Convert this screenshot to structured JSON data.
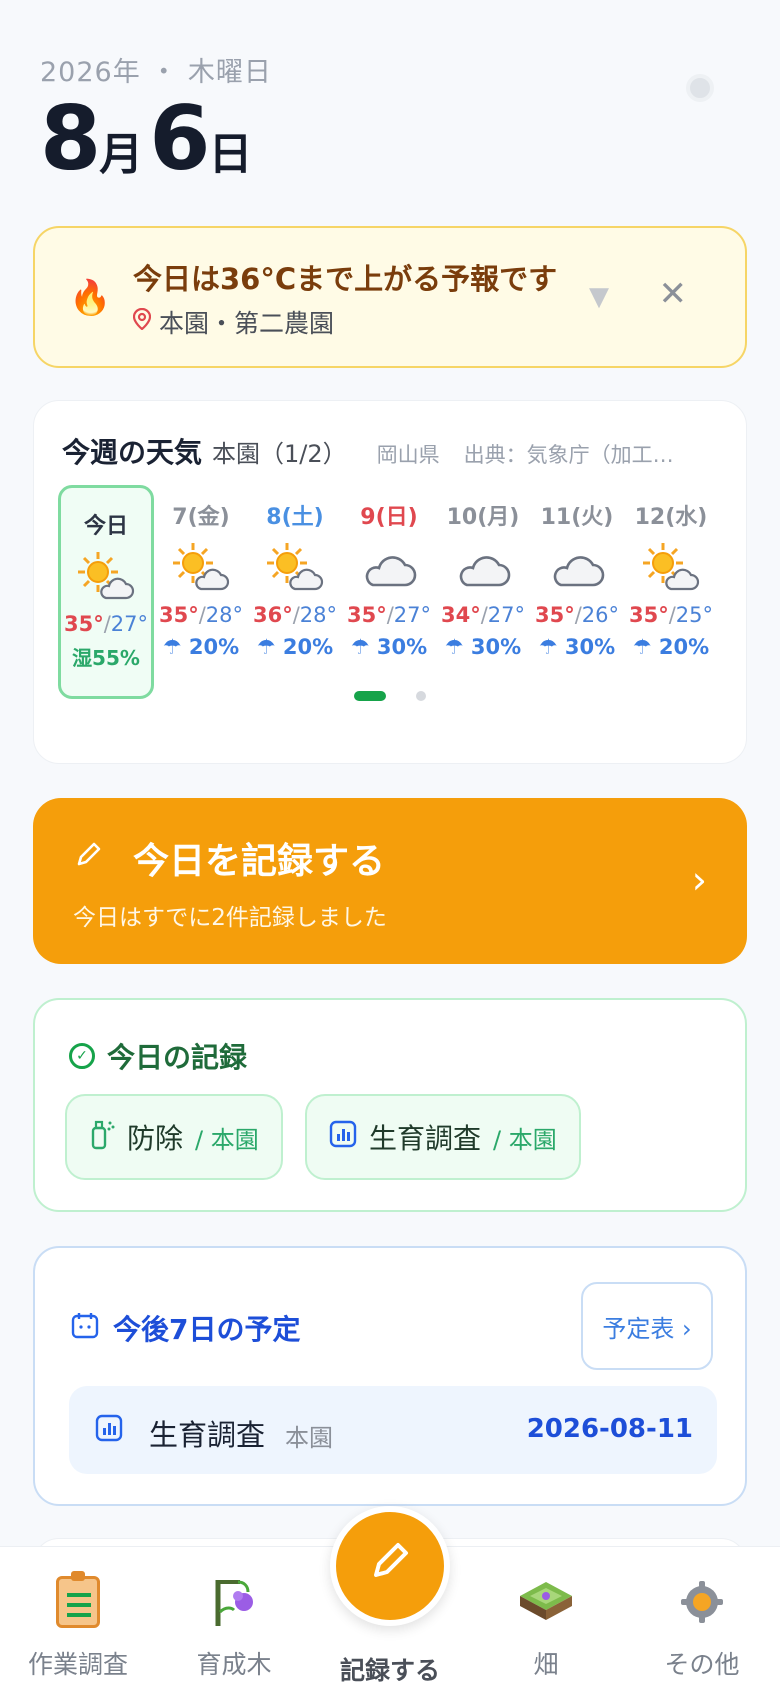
{
  "header": {
    "year_weekday": "2026年 ・ 木曜日",
    "month": "8",
    "month_unit": "月",
    "day": "6",
    "day_unit": "日"
  },
  "alert": {
    "icon": "fire-icon",
    "title": "今日は36°Cまで上がる予報です",
    "location": "本園・第二農園",
    "collapse_glyph": "▼",
    "close_glyph": "✕"
  },
  "weather": {
    "title": "今週の天気",
    "farm": "本園（1/2）",
    "region": "岡山県",
    "source": "出典：気象庁（加工し…",
    "days": [
      {
        "name": "今日",
        "icon": "sun-cloud",
        "hi": "35°",
        "lo": "27°",
        "humidity": "湿55%",
        "today": true
      },
      {
        "name": "7(金)",
        "icon": "sun-cloud",
        "hi": "35°",
        "lo": "28°",
        "rain": "☂ 20%"
      },
      {
        "name": "8(土)",
        "icon": "sun-cloud",
        "hi": "36°",
        "lo": "28°",
        "rain": "☂ 20%",
        "kind": "sat"
      },
      {
        "name": "9(日)",
        "icon": "cloud",
        "hi": "35°",
        "lo": "27°",
        "rain": "☂ 30%",
        "kind": "sun"
      },
      {
        "name": "10(月)",
        "icon": "cloud",
        "hi": "34°",
        "lo": "27°",
        "rain": "☂ 30%"
      },
      {
        "name": "11(火)",
        "icon": "cloud",
        "hi": "35°",
        "lo": "26°",
        "rain": "☂ 30%"
      },
      {
        "name": "12(水)",
        "icon": "sun-cloud",
        "hi": "35°",
        "lo": "25°",
        "rain": "☂ 20%"
      }
    ],
    "page": 1,
    "pages": 2
  },
  "record_button": {
    "title": "今日を記録する",
    "subtitle": "今日はすでに2件記録しました",
    "chevron": "›"
  },
  "today_records": {
    "title": "今日の記録",
    "items": [
      {
        "name": "防除",
        "place": "/ 本園",
        "icon": "spray-icon"
      },
      {
        "name": "生育調査",
        "place": "/ 本園",
        "icon": "chart-icon"
      }
    ]
  },
  "schedule": {
    "title": "今後7日の予定",
    "button": "予定表 ›",
    "items": [
      {
        "name": "生育調査",
        "place": "本園",
        "date": "2026-08-11"
      }
    ]
  },
  "tabbar": {
    "tabs": [
      {
        "label": "作業調査",
        "icon": "clipboard-icon"
      },
      {
        "label": "育成木",
        "icon": "tree-icon"
      },
      {
        "label": "記録する",
        "icon": "pencil-icon"
      },
      {
        "label": "畑",
        "icon": "field-icon"
      },
      {
        "label": "その他",
        "icon": "gear-icon"
      }
    ]
  },
  "colors": {
    "accent_orange": "#f59e0b",
    "green": "#16a34a",
    "blue": "#1d4ed8",
    "hot_red": "#e0484f"
  }
}
